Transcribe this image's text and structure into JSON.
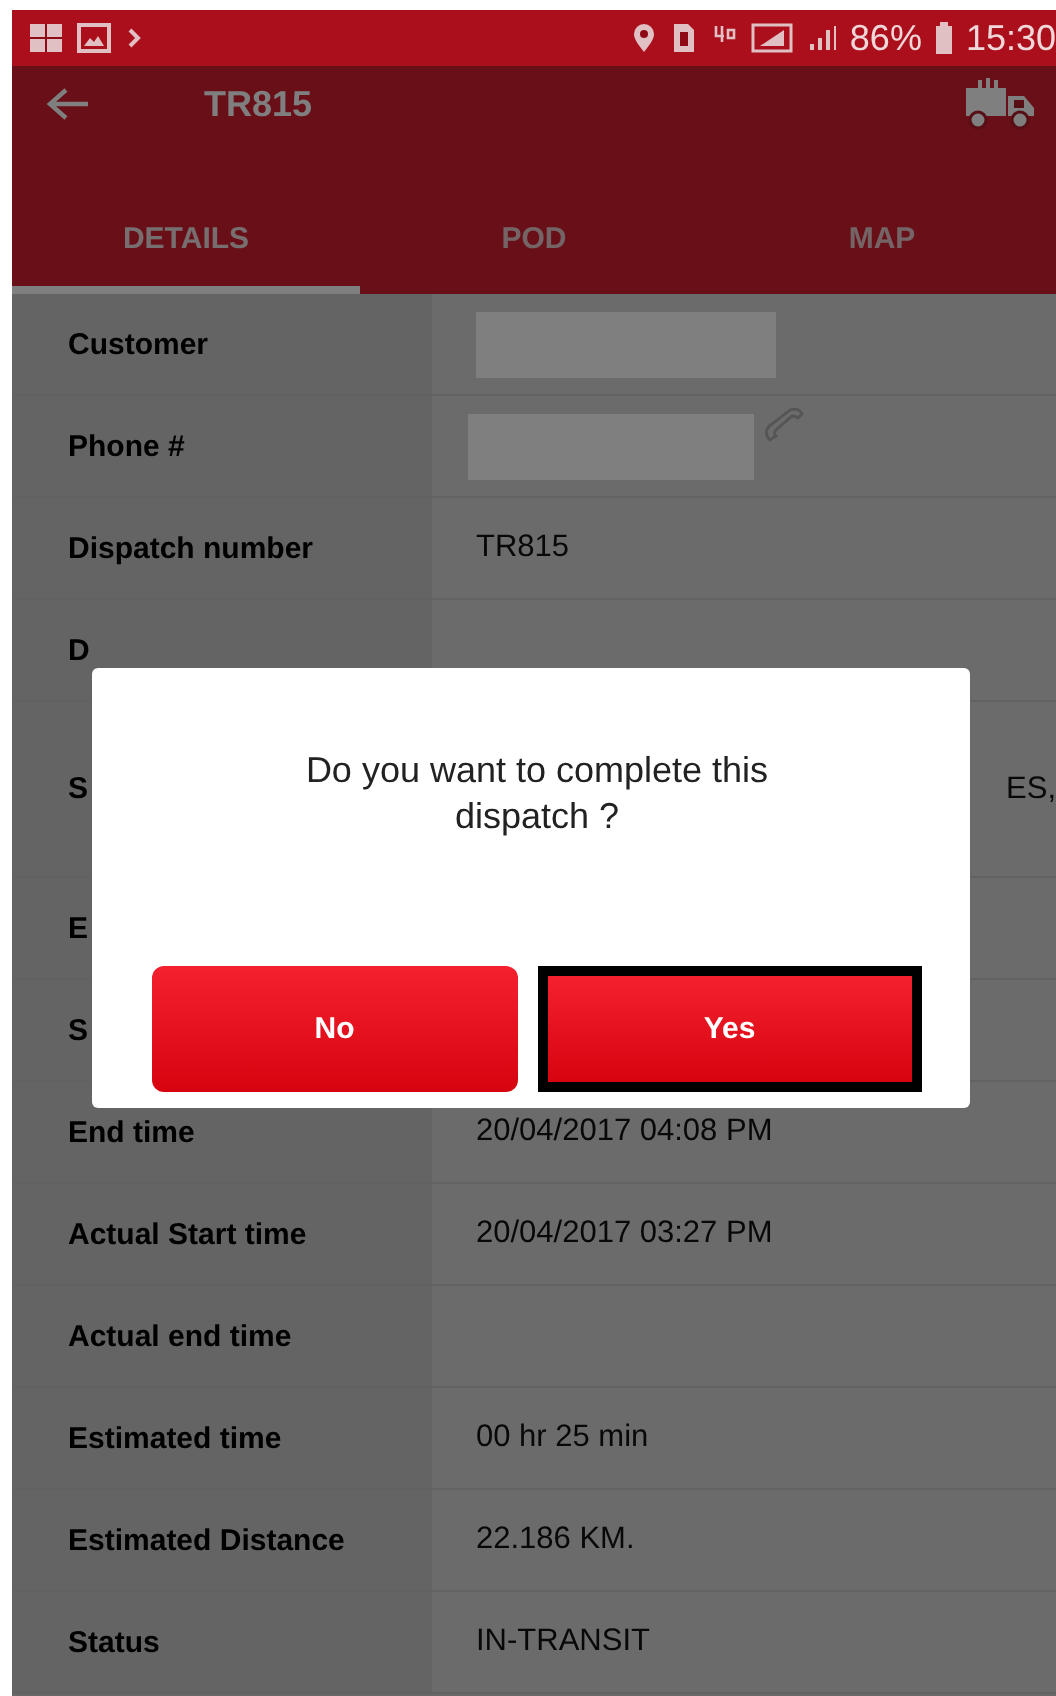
{
  "status_bar": {
    "battery": "86%",
    "time": "15:30"
  },
  "app_bar": {
    "title": "TR815"
  },
  "tabs": [
    {
      "label": "DETAILS",
      "selected": true
    },
    {
      "label": "POD",
      "selected": false
    },
    {
      "label": "MAP",
      "selected": false
    }
  ],
  "details": [
    {
      "label": "Customer",
      "kind": "redacted"
    },
    {
      "label": "Phone #",
      "kind": "phone"
    },
    {
      "label": "Dispatch number",
      "value": "TR815",
      "kind": "text"
    },
    {
      "label": "D",
      "kind": "text"
    },
    {
      "label": "S",
      "value": "ES,",
      "kind": "tall"
    },
    {
      "label": "E",
      "kind": "text"
    },
    {
      "label": "S",
      "kind": "text"
    },
    {
      "label": "End time",
      "value": "20/04/2017 04:08 PM",
      "kind": "text"
    },
    {
      "label": "Actual Start time",
      "value": "20/04/2017 03:27 PM",
      "kind": "text"
    },
    {
      "label": "Actual end time",
      "kind": "text"
    },
    {
      "label": "Estimated time",
      "value": "00 hr 25 min",
      "kind": "text"
    },
    {
      "label": "Estimated Distance",
      "value": "22.186 KM.",
      "kind": "text"
    },
    {
      "label": "Status",
      "value": "IN-TRANSIT",
      "kind": "text"
    }
  ],
  "dialog": {
    "message": "Do you want to complete this dispatch ?",
    "buttons": [
      {
        "label": "No",
        "focused": false
      },
      {
        "label": "Yes",
        "focused": true
      }
    ]
  }
}
